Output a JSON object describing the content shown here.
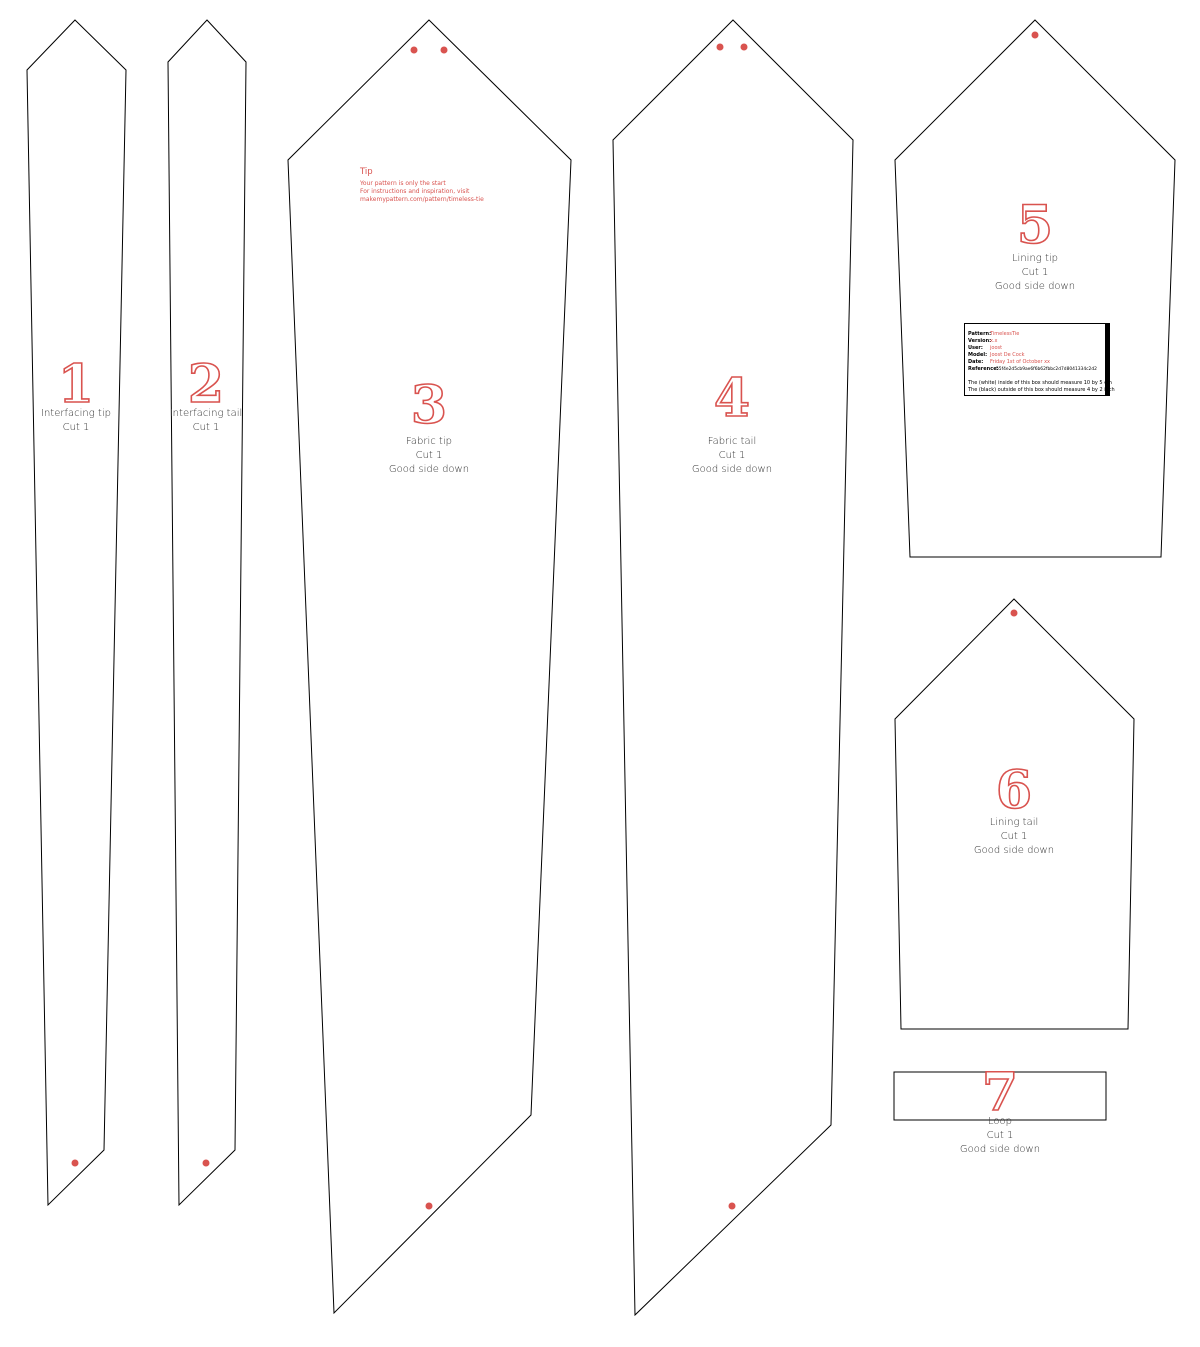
{
  "pieces": [
    {
      "number": "1",
      "name": "Interfacing tip",
      "cut": "Cut 1",
      "side": ""
    },
    {
      "number": "2",
      "name": "Interfacing tail",
      "cut": "Cut 1",
      "side": ""
    },
    {
      "number": "3",
      "name": "Fabric tip",
      "cut": "Cut 1",
      "side": "Good side down"
    },
    {
      "number": "4",
      "name": "Fabric tail",
      "cut": "Cut 1",
      "side": "Good side down"
    },
    {
      "number": "5",
      "name": "Lining tip",
      "cut": "Cut 1",
      "side": "Good side down"
    },
    {
      "number": "6",
      "name": "Lining tail",
      "cut": "Cut 1",
      "side": "Good side down"
    },
    {
      "number": "7",
      "name": "Loop",
      "cut": "Cut 1",
      "side": "Good side down"
    }
  ],
  "tip": {
    "title": "Tip",
    "line1": "Your pattern is only the start",
    "line2": "For instructions and inspiration, visit",
    "line3": "makemypattern.com/pattern/timeless-tie"
  },
  "info_box": {
    "rows": [
      {
        "key": "Pattern:",
        "value": "TimelessTie"
      },
      {
        "key": "Version:",
        "value": "x.x"
      },
      {
        "key": "User:",
        "value": "joost"
      },
      {
        "key": "Model:",
        "value": "Joost De Cock"
      },
      {
        "key": "Date:",
        "value": "Friday 1st of October xx"
      }
    ],
    "reference_key": "Reference:",
    "reference_value": "55f4e2d5cb9ae6f6b62fbbc2d7d8041334c2d2",
    "note1": "The (white) inside of this box should measure 10 by 5 cm",
    "note2": "The (black) outside of this box should measure 4 by 2 inch"
  },
  "colors": {
    "accent": "#d9534f",
    "outline": "#000000"
  }
}
